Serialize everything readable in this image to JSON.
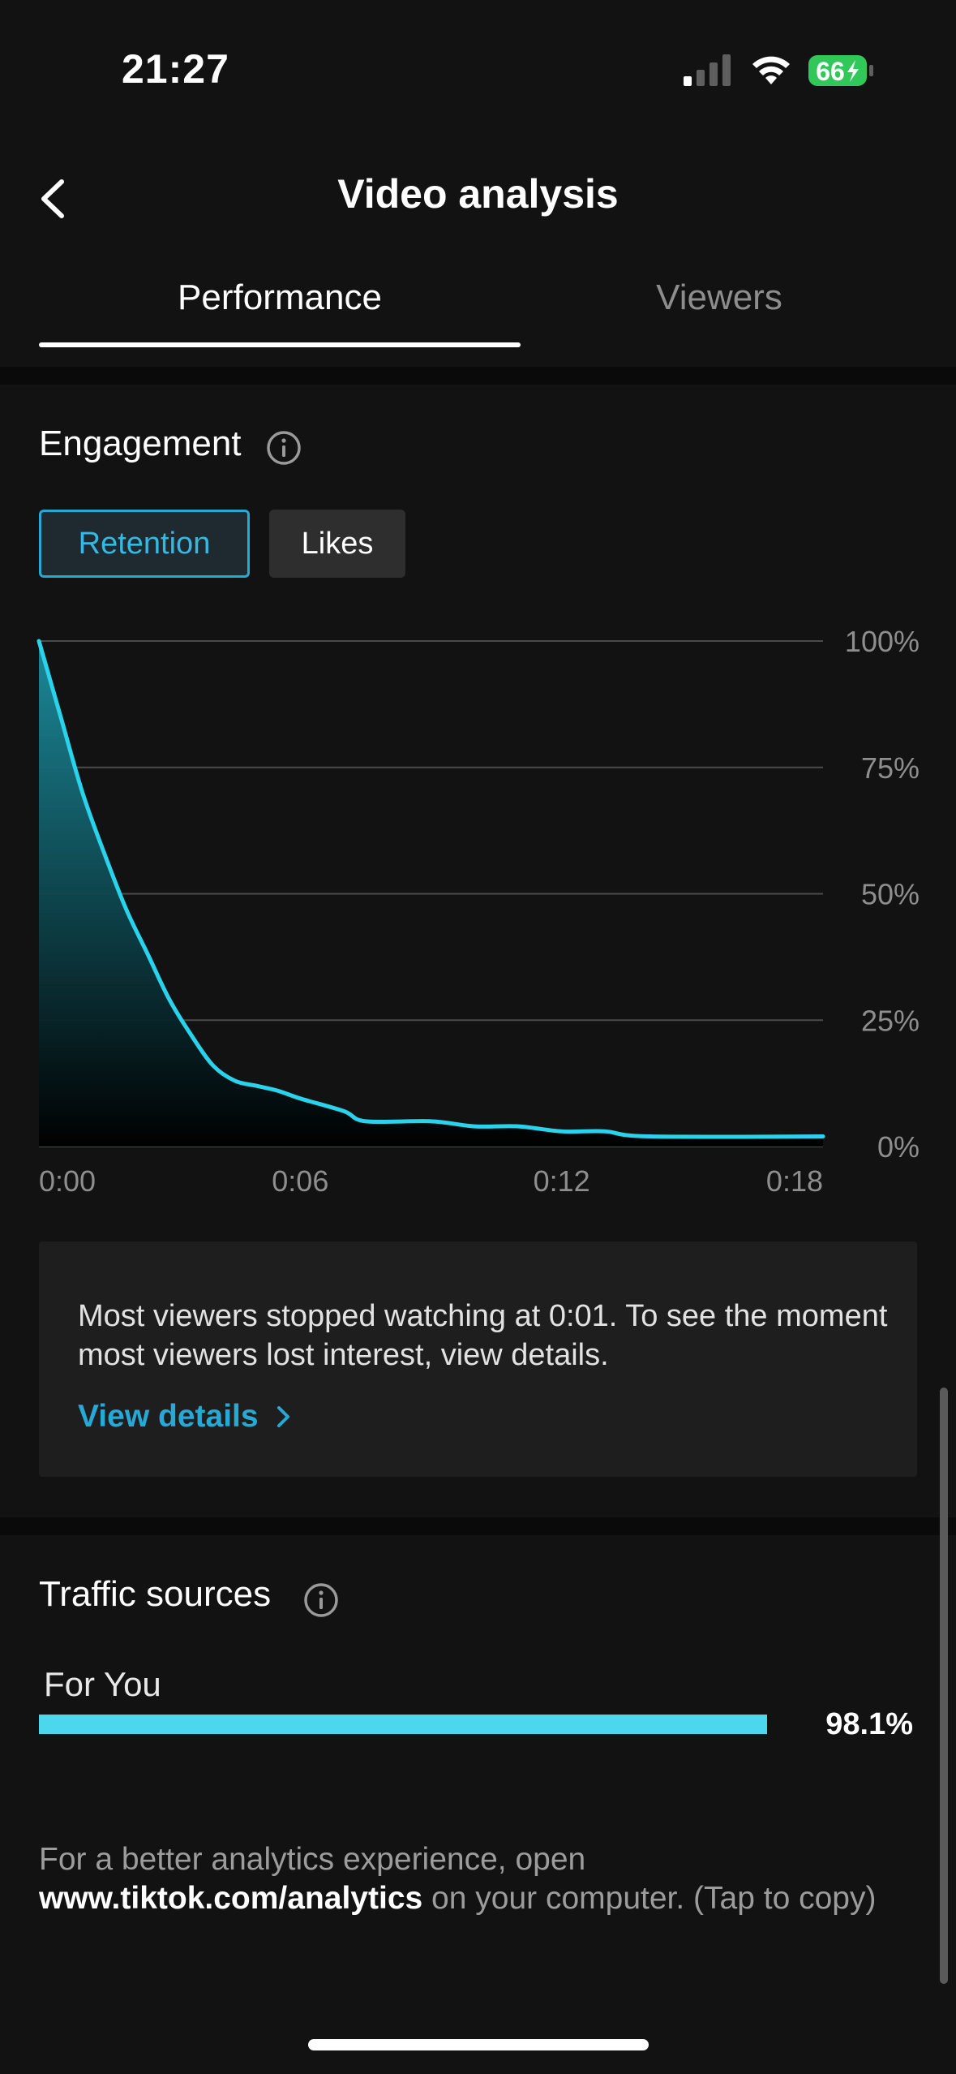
{
  "status_bar": {
    "time": "21:27",
    "battery_level": "66",
    "signal_bars_active": 1,
    "signal_bars_total": 4,
    "battery_color": "#32c759"
  },
  "header": {
    "title": "Video analysis",
    "back_icon": "chevron-left-icon"
  },
  "tabs": [
    {
      "label": "Performance",
      "active": true
    },
    {
      "label": "Viewers",
      "active": false
    }
  ],
  "engagement": {
    "title": "Engagement",
    "toggles": [
      {
        "label": "Retention",
        "selected": true
      },
      {
        "label": "Likes",
        "selected": false
      }
    ],
    "accent_color": "#27a9d6"
  },
  "chart_data": {
    "type": "area",
    "title": "",
    "xlabel": "",
    "ylabel": "",
    "x_ticks": [
      "0:00",
      "0:06",
      "0:12",
      "0:18"
    ],
    "y_ticks": [
      "100%",
      "75%",
      "50%",
      "25%",
      "0%"
    ],
    "ylim": [
      0,
      100
    ],
    "xlim": [
      0,
      18
    ],
    "grid": true,
    "series": [
      {
        "x": [
          0,
          0.5,
          1,
          1.5,
          2,
          2.5,
          3,
          3.5,
          4,
          4.5,
          5,
          5.5,
          6,
          7,
          7.5,
          9,
          10,
          11,
          12,
          13,
          14,
          18
        ],
        "values": [
          100,
          85,
          70,
          58,
          47,
          38,
          29,
          22,
          16,
          13,
          12,
          11,
          9.5,
          7,
          5,
          5,
          4,
          4,
          3,
          3,
          2,
          2
        ]
      }
    ],
    "line_color": "#29d3eb"
  },
  "insight": {
    "text": "Most viewers stopped watching at 0:01. To see the moment most viewers lost interest, view details.",
    "link_label": "View details"
  },
  "traffic_sources": {
    "title": "Traffic sources",
    "items": [
      {
        "label": "For You",
        "value_label": "98.1%",
        "value": 98.1
      }
    ],
    "bar_color": "#4bd8ec"
  },
  "footer": {
    "prefix": "For a better analytics experience, open ",
    "link": "www.tiktok.com/analytics",
    "suffix": " on your computer. (Tap to copy)"
  }
}
